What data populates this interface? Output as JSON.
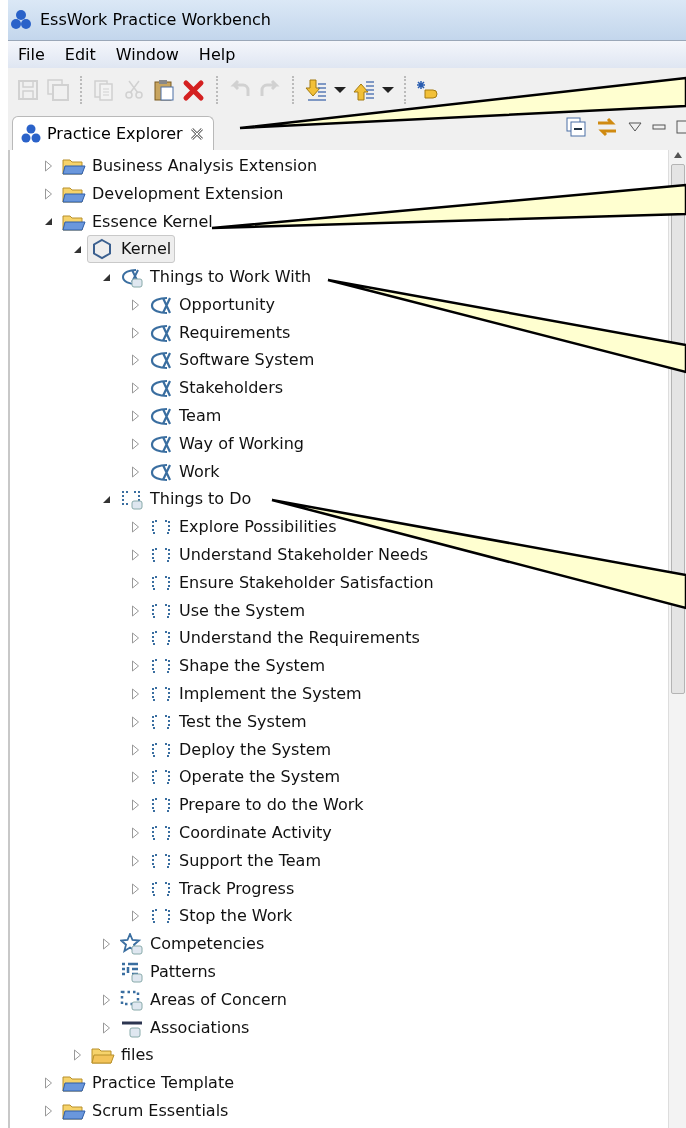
{
  "window": {
    "title": "EssWork Practice Workbench"
  },
  "menu": [
    {
      "label": "File"
    },
    {
      "label": "Edit"
    },
    {
      "label": "Window"
    },
    {
      "label": "Help"
    }
  ],
  "toolbar": [
    {
      "kind": "save",
      "disabled": true
    },
    {
      "kind": "save-all",
      "disabled": true
    },
    {
      "kind": "separator"
    },
    {
      "kind": "copy",
      "disabled": true
    },
    {
      "kind": "cut",
      "disabled": true
    },
    {
      "kind": "paste",
      "disabled": false
    },
    {
      "kind": "delete",
      "disabled": false
    },
    {
      "kind": "separator"
    },
    {
      "kind": "undo",
      "disabled": true
    },
    {
      "kind": "redo",
      "disabled": true
    },
    {
      "kind": "separator"
    },
    {
      "kind": "import",
      "disabled": false
    },
    {
      "kind": "dropdown",
      "disabled": false
    },
    {
      "kind": "export",
      "disabled": false
    },
    {
      "kind": "dropdown",
      "disabled": false
    },
    {
      "kind": "separator"
    },
    {
      "kind": "new",
      "disabled": false
    }
  ],
  "view": {
    "tab": {
      "label": "Practice Explorer",
      "selected": true
    },
    "tree": [
      {
        "label": "Business Analysis Extension",
        "kind": "practice",
        "expandable": true,
        "expanded": false,
        "selected": false
      },
      {
        "label": "Development Extension",
        "kind": "practice",
        "expandable": true,
        "expanded": false,
        "selected": false
      },
      {
        "label": "Essence Kernel",
        "kind": "practice",
        "expandable": true,
        "expanded": true,
        "selected": false,
        "children": [
          {
            "label": "Kernel",
            "kind": "kernel",
            "expandable": true,
            "expanded": true,
            "selected": true,
            "children": [
              {
                "label": "Things to Work With",
                "kind": "alpha-group",
                "expandable": true,
                "expanded": true,
                "selected": false,
                "children": [
                  {
                    "label": "Opportunity",
                    "kind": "alpha",
                    "expandable": true,
                    "expanded": false,
                    "selected": false
                  },
                  {
                    "label": "Requirements",
                    "kind": "alpha",
                    "expandable": true,
                    "expanded": false,
                    "selected": false
                  },
                  {
                    "label": "Software System",
                    "kind": "alpha",
                    "expandable": true,
                    "expanded": false,
                    "selected": false
                  },
                  {
                    "label": "Stakeholders",
                    "kind": "alpha",
                    "expandable": true,
                    "expanded": false,
                    "selected": false
                  },
                  {
                    "label": "Team",
                    "kind": "alpha",
                    "expandable": true,
                    "expanded": false,
                    "selected": false
                  },
                  {
                    "label": "Way of Working",
                    "kind": "alpha",
                    "expandable": true,
                    "expanded": false,
                    "selected": false
                  },
                  {
                    "label": "Work",
                    "kind": "alpha",
                    "expandable": true,
                    "expanded": false,
                    "selected": false
                  }
                ]
              },
              {
                "label": "Things to Do",
                "kind": "activity-group",
                "expandable": true,
                "expanded": true,
                "selected": false,
                "children": [
                  {
                    "label": "Explore Possibilities",
                    "kind": "activity",
                    "expandable": true,
                    "expanded": false,
                    "selected": false
                  },
                  {
                    "label": "Understand Stakeholder Needs",
                    "kind": "activity",
                    "expandable": true,
                    "expanded": false,
                    "selected": false
                  },
                  {
                    "label": "Ensure Stakeholder Satisfaction",
                    "kind": "activity",
                    "expandable": true,
                    "expanded": false,
                    "selected": false
                  },
                  {
                    "label": "Use the System",
                    "kind": "activity",
                    "expandable": true,
                    "expanded": false,
                    "selected": false
                  },
                  {
                    "label": "Understand the Requirements",
                    "kind": "activity",
                    "expandable": true,
                    "expanded": false,
                    "selected": false
                  },
                  {
                    "label": "Shape the System",
                    "kind": "activity",
                    "expandable": true,
                    "expanded": false,
                    "selected": false
                  },
                  {
                    "label": "Implement the System",
                    "kind": "activity",
                    "expandable": true,
                    "expanded": false,
                    "selected": false
                  },
                  {
                    "label": "Test the System",
                    "kind": "activity",
                    "expandable": true,
                    "expanded": false,
                    "selected": false
                  },
                  {
                    "label": "Deploy the System",
                    "kind": "activity",
                    "expandable": true,
                    "expanded": false,
                    "selected": false
                  },
                  {
                    "label": "Operate the System",
                    "kind": "activity",
                    "expandable": true,
                    "expanded": false,
                    "selected": false
                  },
                  {
                    "label": "Prepare to do the Work",
                    "kind": "activity",
                    "expandable": true,
                    "expanded": false,
                    "selected": false
                  },
                  {
                    "label": "Coordinate Activity",
                    "kind": "activity",
                    "expandable": true,
                    "expanded": false,
                    "selected": false
                  },
                  {
                    "label": "Support the Team",
                    "kind": "activity",
                    "expandable": true,
                    "expanded": false,
                    "selected": false
                  },
                  {
                    "label": "Track Progress",
                    "kind": "activity",
                    "expandable": true,
                    "expanded": false,
                    "selected": false
                  },
                  {
                    "label": "Stop the Work",
                    "kind": "activity",
                    "expandable": true,
                    "expanded": false,
                    "selected": false
                  }
                ]
              },
              {
                "label": "Competencies",
                "kind": "competency-group",
                "expandable": true,
                "expanded": false,
                "selected": false
              },
              {
                "label": "Patterns",
                "kind": "pattern-group",
                "selected": false
              },
              {
                "label": "Areas of Concern",
                "kind": "area-group",
                "expandable": true,
                "expanded": false,
                "selected": false
              },
              {
                "label": "Associations",
                "kind": "association-group",
                "expandable": true,
                "expanded": false,
                "selected": false
              }
            ]
          },
          {
            "label": "files",
            "kind": "folder",
            "expandable": true,
            "expanded": false,
            "selected": false
          }
        ]
      },
      {
        "label": "Practice Template",
        "kind": "practice",
        "expandable": true,
        "expanded": false,
        "selected": false
      },
      {
        "label": "Scrum Essentials",
        "kind": "practice",
        "expandable": true,
        "expanded": false,
        "selected": false
      }
    ]
  }
}
